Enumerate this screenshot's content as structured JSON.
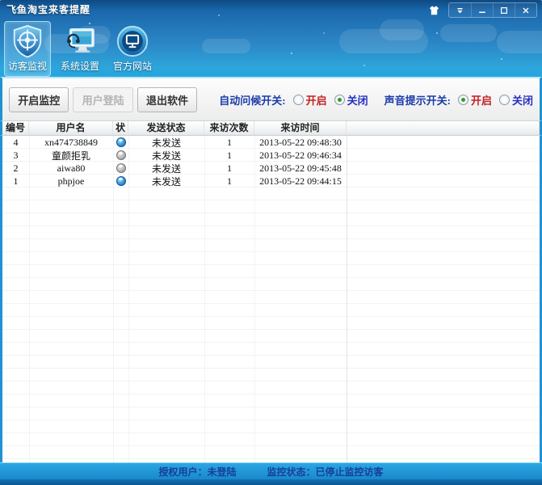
{
  "colors": {
    "header_top": "#0d4a82",
    "header_bottom": "#23a7de",
    "accent_blue": "#1f93d2",
    "on_option_text": "#c32222",
    "off_option_text": "#2530c0",
    "switch_label_text": "#1c3caa",
    "statusbar_bg": "#1f97d6",
    "statusbar_text": "#173f9b",
    "online_icon": "#2b8fd8",
    "offline_icon": "#9a9a9a"
  },
  "icons": {
    "skin": "shirt-icon",
    "menu": "chevron-down-icon",
    "minimize": "minimize-icon",
    "maximize": "maximize-icon",
    "close": "close-icon",
    "visitor_monitor": "shield-target-icon",
    "system_settings": "monitor-headset-icon",
    "official_site": "globe-monitor-icon",
    "row_status_online": "wangwang-online-icon",
    "row_status_offline": "wangwang-offline-icon"
  },
  "titlebar": {
    "title": "飞鱼淘宝来客提醒"
  },
  "toolbar": {
    "items": [
      {
        "label": "访客监视",
        "active": true
      },
      {
        "label": "系统设置",
        "active": false
      },
      {
        "label": "官方网站",
        "active": false
      }
    ]
  },
  "actions": {
    "start_label": "开启监控",
    "login_label": "用户登陆",
    "exit_label": "退出软件"
  },
  "switches": {
    "greeting": {
      "label": "自动问候开关:",
      "on_label": "开启",
      "on_checked": "false",
      "off_label": "关闭",
      "off_checked": "true"
    },
    "sound": {
      "label": "声音提示开关:",
      "on_label": "开启",
      "on_checked": "true",
      "off_label": "关闭",
      "off_checked": "false"
    }
  },
  "table": {
    "columns": [
      "编号",
      "用户名",
      "状",
      "发送状态",
      "来访次数",
      "来访时间"
    ],
    "rows": [
      {
        "no": "4",
        "username": "xn474738849",
        "status": "online",
        "send_status": "未发送",
        "visits": "1",
        "time": "2013-05-22 09:48:30"
      },
      {
        "no": "3",
        "username": "童颜拒乳",
        "status": "offline",
        "send_status": "未发送",
        "visits": "1",
        "time": "2013-05-22 09:46:34"
      },
      {
        "no": "2",
        "username": "aiwa80",
        "status": "offline",
        "send_status": "未发送",
        "visits": "1",
        "time": "2013-05-22 09:45:48"
      },
      {
        "no": "1",
        "username": "phpjoe",
        "status": "online",
        "send_status": "未发送",
        "visits": "1",
        "time": "2013-05-22 09:44:15"
      }
    ]
  },
  "statusbar": {
    "auth": "授权用户：未登陆",
    "monitor": "监控状态：已停止监控访客"
  }
}
